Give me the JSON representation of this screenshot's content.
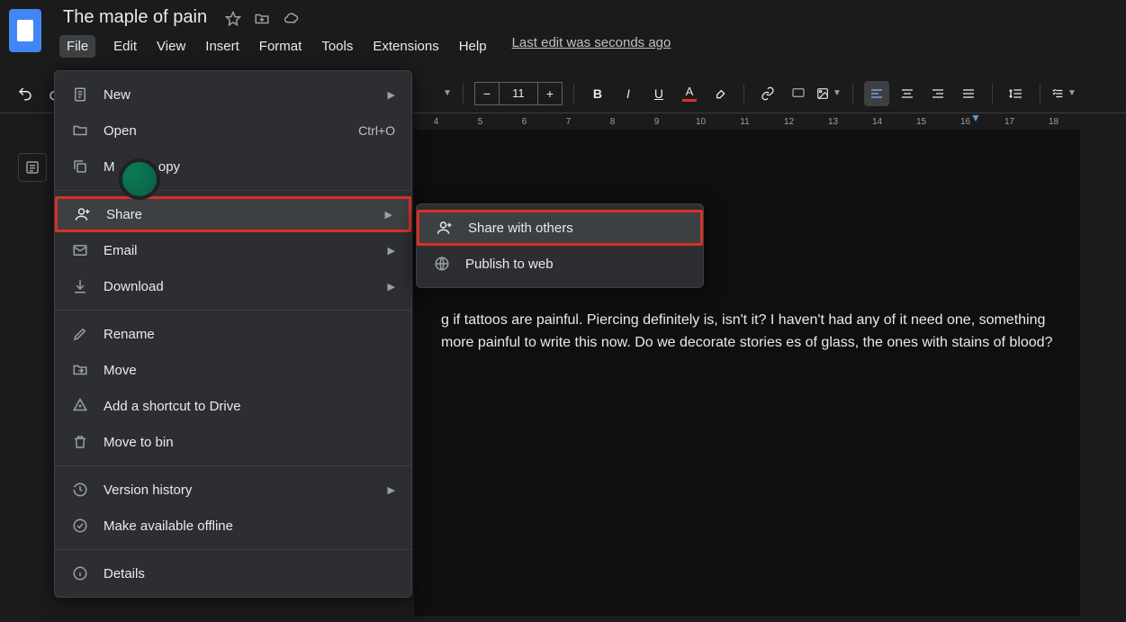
{
  "doc": {
    "title": "The maple of pain",
    "last_edit": "Last edit was seconds ago"
  },
  "menubar": [
    "File",
    "Edit",
    "View",
    "Insert",
    "Format",
    "Tools",
    "Extensions",
    "Help"
  ],
  "toolbar": {
    "font_size": "11"
  },
  "ruler": [
    "4",
    "5",
    "6",
    "7",
    "8",
    "9",
    "10",
    "11",
    "12",
    "13",
    "14",
    "15",
    "16",
    "17",
    "18"
  ],
  "file_menu": {
    "new": "New",
    "open": "Open",
    "open_shortcut": "Ctrl+O",
    "make_copy_prefix": "M",
    "make_copy_suffix": "opy",
    "share": "Share",
    "email": "Email",
    "download": "Download",
    "rename": "Rename",
    "move": "Move",
    "shortcut": "Add a shortcut to Drive",
    "bin": "Move to bin",
    "version": "Version history",
    "offline": "Make available offline",
    "details": "Details"
  },
  "share_submenu": {
    "share_others": "Share with others",
    "publish": "Publish to web"
  },
  "body_text": "g if tattoos are painful. Piercing definitely is, isn't it? I haven't had any of it  need one, something more painful to write this now. Do we decorate stories es of glass, the ones with stains of blood?"
}
